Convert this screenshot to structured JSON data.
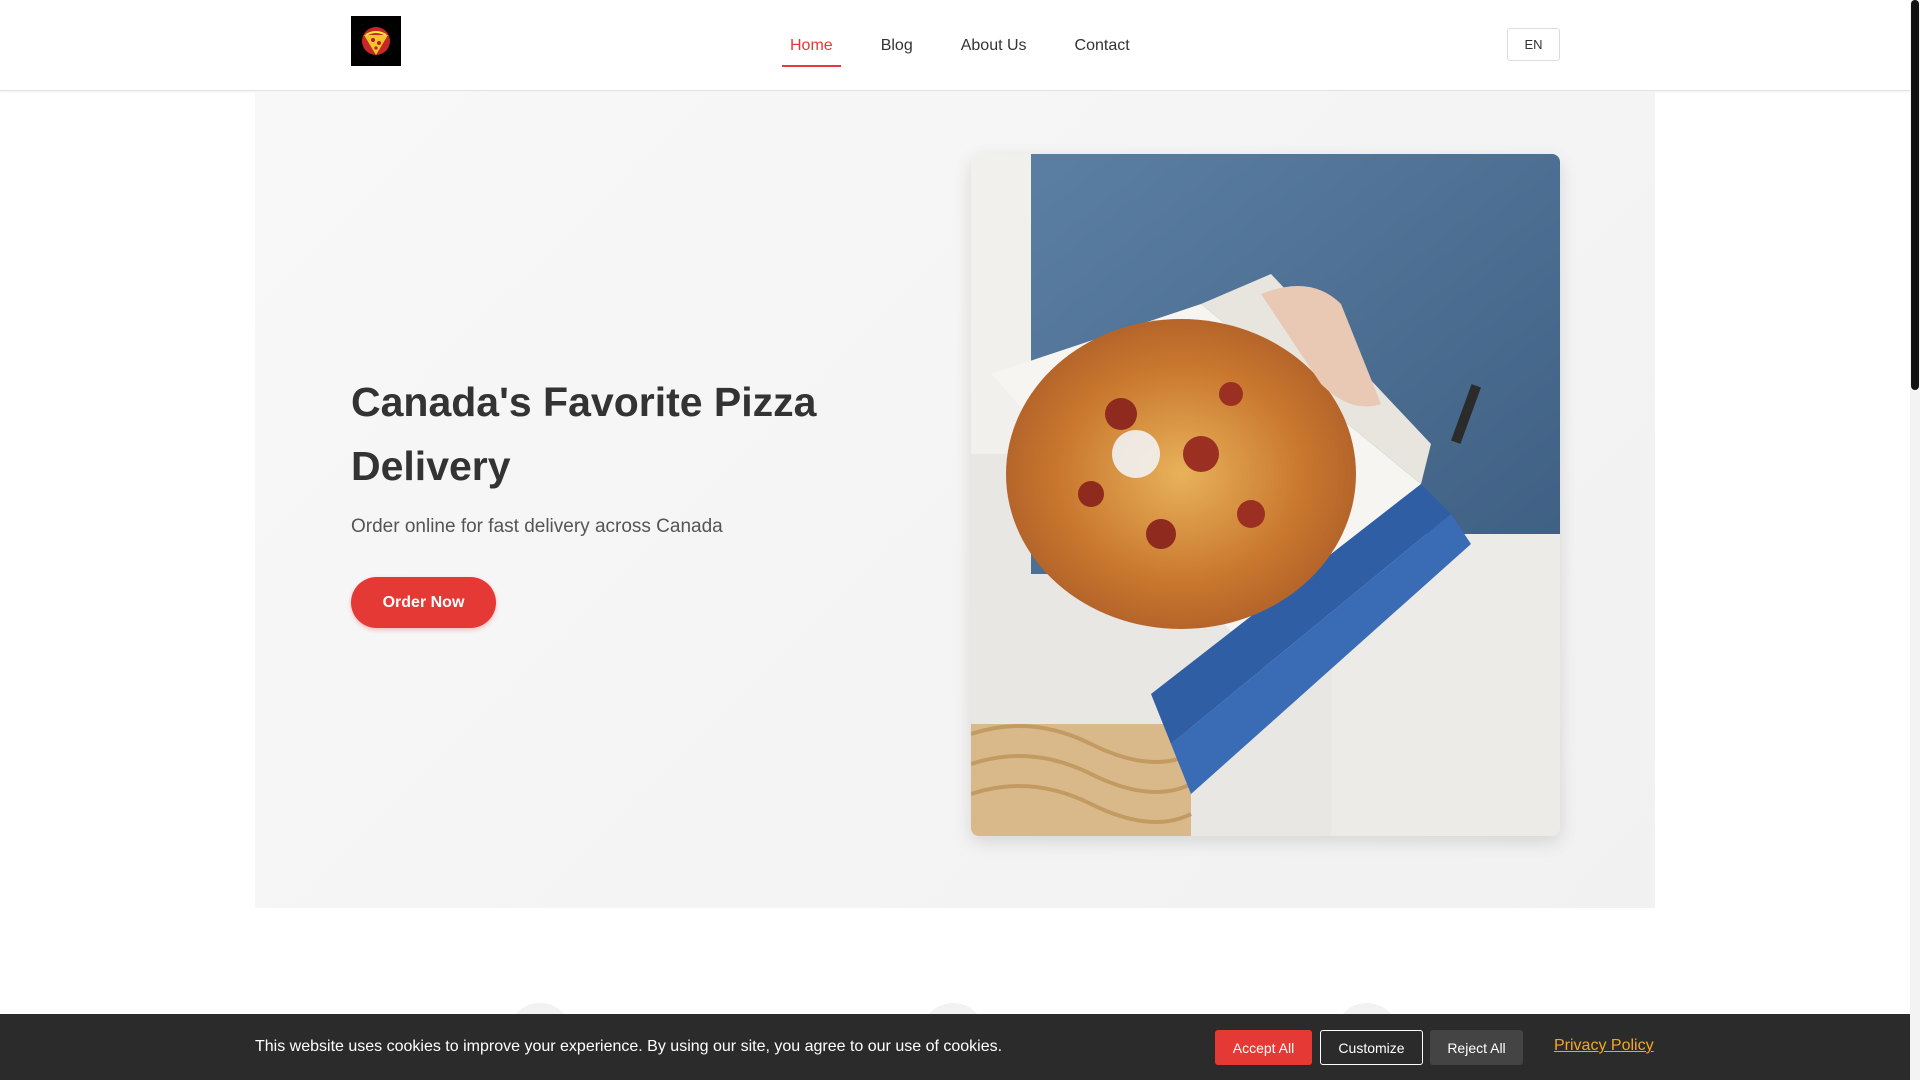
{
  "header": {
    "logo_icon": "pizza-logo-icon",
    "nav": [
      {
        "label": "Home",
        "active": true
      },
      {
        "label": "Blog",
        "active": false
      },
      {
        "label": "About Us",
        "active": false
      },
      {
        "label": "Contact",
        "active": false
      }
    ],
    "language": "EN"
  },
  "hero": {
    "title": "Canada's Favorite Pizza Delivery",
    "subtitle": "Order online for fast delivery across Canada",
    "cta_label": "Order Now",
    "image_icon": "pizza-box-photo"
  },
  "cookie_banner": {
    "message": "This website uses cookies to improve your experience. By using our site, you agree to our use of cookies.",
    "accept_label": "Accept All",
    "customize_label": "Customize",
    "reject_label": "Reject All",
    "privacy_label": "Privacy Policy"
  },
  "colors": {
    "accent": "#e53935",
    "cookie_bg": "#2b2b2b",
    "privacy_link": "#f5a623"
  }
}
